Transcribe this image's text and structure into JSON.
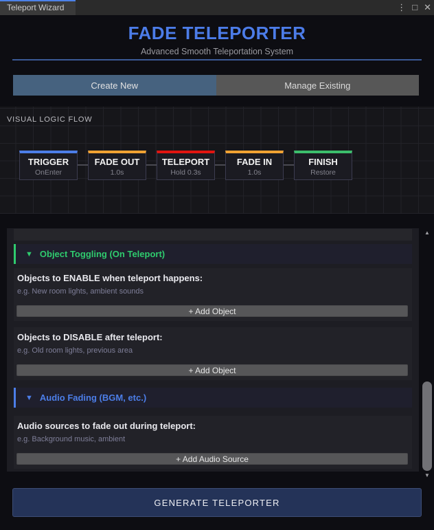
{
  "window": {
    "tab_title": "Teleport Wizard",
    "controls": {
      "menu_icon": "⋮",
      "maximize_icon": "□",
      "close_icon": "✕"
    }
  },
  "header": {
    "title": "FADE TELEPORTER",
    "subtitle": "Advanced Smooth Teleportation System"
  },
  "tabs": [
    {
      "label": "Create New",
      "active": true
    },
    {
      "label": "Manage Existing",
      "active": false
    }
  ],
  "flow": {
    "label": "VISUAL LOGIC FLOW",
    "nodes": [
      {
        "title": "TRIGGER",
        "subtitle": "OnEnter",
        "color": "#4c7ee8"
      },
      {
        "title": "FADE OUT",
        "subtitle": "1.0s",
        "color": "#f0a232"
      },
      {
        "title": "TELEPORT",
        "subtitle": "Hold 0.3s",
        "color": "#e01410"
      },
      {
        "title": "FADE IN",
        "subtitle": "1.0s",
        "color": "#f0a232"
      },
      {
        "title": "FINISH",
        "subtitle": "Restore",
        "color": "#3cbe6c"
      }
    ]
  },
  "icons": {
    "collapse_marker": "▼",
    "scroll_up": "▲",
    "scroll_down": "▼"
  },
  "sections": [
    {
      "title": "Object Toggling (On Teleport)",
      "accent": "#2fcb6e",
      "groups": [
        {
          "label": "Objects to ENABLE when teleport happens:",
          "hint": "e.g. New room lights, ambient sounds",
          "button": "+ Add Object"
        },
        {
          "label": "Objects to DISABLE after teleport:",
          "hint": "e.g. Old room lights, previous area",
          "button": "+ Add Object"
        }
      ]
    },
    {
      "title": "Audio Fading (BGM, etc.)",
      "accent": "#4c7ee8",
      "groups": [
        {
          "label": "Audio sources to fade out during teleport:",
          "hint": "e.g. Background music, ambient",
          "button": "+ Add Audio Source"
        }
      ]
    }
  ],
  "generate_button_label": "GENERATE TELEPORTER"
}
